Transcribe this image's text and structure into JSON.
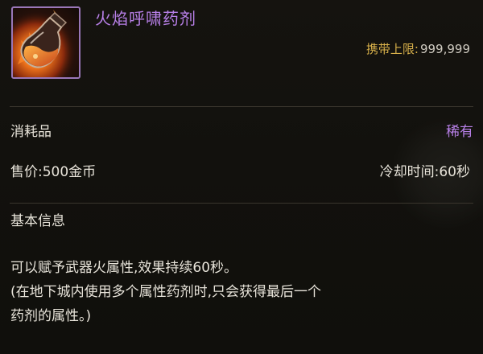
{
  "item": {
    "name": "火焰呼啸药剂",
    "icon": "fire-potion-flask-icon",
    "carry_limit_label": "携带上限:",
    "carry_limit_value": "999,999",
    "type": "消耗品",
    "rarity": "稀有",
    "price": "售价:500金币",
    "cooldown": "冷却时间:60秒"
  },
  "basic_info": {
    "title": "基本信息",
    "lines": [
      "可以赋予武器火属性,效果持续60秒。",
      "(在地下城内使用多个属性药剂时,只会获得最后一个",
      "药剂的属性。)"
    ]
  },
  "colors": {
    "name": "#b880e8",
    "rarity": "#b880e8",
    "carry_label": "#d8b04a",
    "frame_border": "#9a77b8",
    "background": "#12110d"
  }
}
